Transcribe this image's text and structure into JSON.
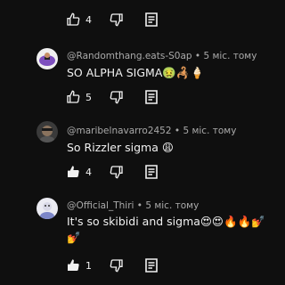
{
  "top_actions": {
    "like_count": "4"
  },
  "comments": [
    {
      "author": "@Randomthang.eats-S0ap",
      "time": "5 міс. тому",
      "text": "SO ALPHA SIGMA🤢🦂🍦",
      "like_count": "5",
      "avatar_colors": [
        "#f3f3f3",
        "#7d4fbe"
      ]
    },
    {
      "author": "@maribelnavarro2452",
      "time": "5 міс. тому",
      "text": "So Rizzler sigma 😩",
      "like_count": "4",
      "avatar_colors": [
        "#2d2d2d",
        "#5b4a3a"
      ]
    },
    {
      "author": "@Official_Thiri",
      "time": "5 міс. тому",
      "text_line1": "It's so skibidi and sigma😍😍🔥🔥💅",
      "text_line2": "💅",
      "like_count": "1",
      "avatar_colors": [
        "#e8e8f0",
        "#7c86c8"
      ]
    }
  ],
  "separator": "•",
  "icons": {
    "like": "thumb-up-icon",
    "dislike": "thumb-down-icon",
    "reply": "reply-comment-icon"
  }
}
